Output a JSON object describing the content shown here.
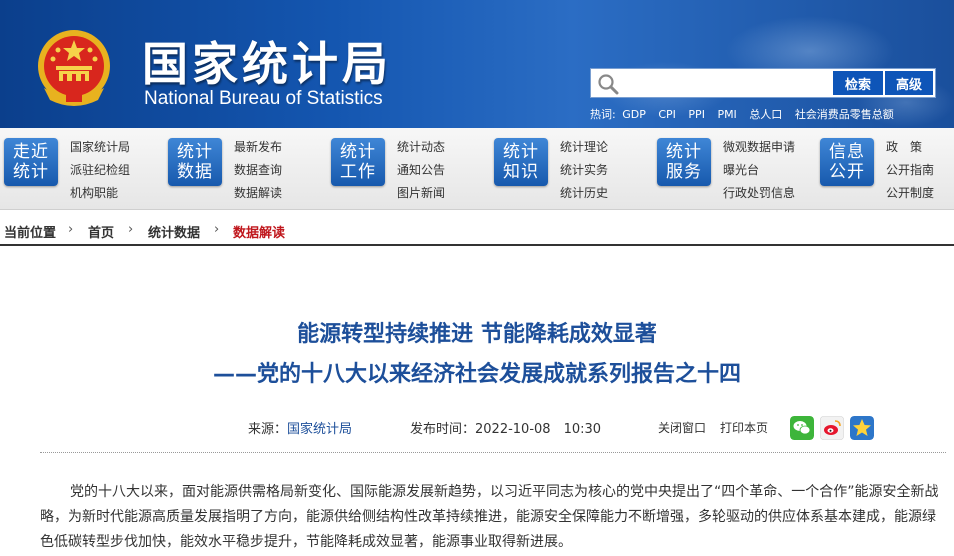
{
  "header": {
    "cn_title": "国家统计局",
    "en_title": "National Bureau of Statistics",
    "search": {
      "value": "",
      "search_label": "检索",
      "advanced_label": "高级"
    },
    "hot_label": "热词:",
    "hot_words": [
      "GDP",
      "CPI",
      "PPI",
      "PMI",
      "总人口",
      "社会消费品零售总额"
    ]
  },
  "nav": [
    {
      "tile": [
        "走近",
        "统计"
      ],
      "links": [
        "国家统计局",
        "派驻纪检组",
        "机构职能"
      ]
    },
    {
      "tile": [
        "统计",
        "数据"
      ],
      "links": [
        "最新发布",
        "数据查询",
        "数据解读"
      ]
    },
    {
      "tile": [
        "统计",
        "工作"
      ],
      "links": [
        "统计动态",
        "通知公告",
        "图片新闻"
      ]
    },
    {
      "tile": [
        "统计",
        "知识"
      ],
      "links": [
        "统计理论",
        "统计实务",
        "统计历史"
      ]
    },
    {
      "tile": [
        "统计",
        "服务"
      ],
      "links": [
        "微观数据申请",
        "曝光台",
        "行政处罚信息"
      ]
    },
    {
      "tile": [
        "信息",
        "公开"
      ],
      "links": [
        "政　策",
        "公开指南",
        "公开制度"
      ]
    }
  ],
  "breadcrumb": {
    "label": "当前位置",
    "sep": "›",
    "items": [
      "首页",
      "统计数据",
      "数据解读"
    ]
  },
  "article": {
    "title": "能源转型持续推进  节能降耗成效显著",
    "subtitle": "——党的十八大以来经济社会发展成就系列报告之十四",
    "source_label": "来源：",
    "source": "国家统计局",
    "date_label": "发布时间：",
    "date": "2022-10-08　10:30",
    "close_label": "关闭窗口",
    "print_label": "打印本页",
    "paragraph": "党的十八大以来，面对能源供需格局新变化、国际能源发展新趋势，以习近平同志为核心的党中央提出了“四个革命、一个合作”能源安全新战略，为新时代能源高质量发展指明了方向，能源供给侧结构性改革持续推进，能源安全保障能力不断增强，多轮驱动的供应体系基本建成，能源绿色低碳转型步伐加快，能效水平稳步提升，节能降耗成效显著，能源事业取得新进展。"
  },
  "colors": {
    "header_blue": "#1456b0",
    "tile_blue": "#1759ad",
    "title_blue": "#1d4f9a",
    "current_red": "#c0171d"
  }
}
